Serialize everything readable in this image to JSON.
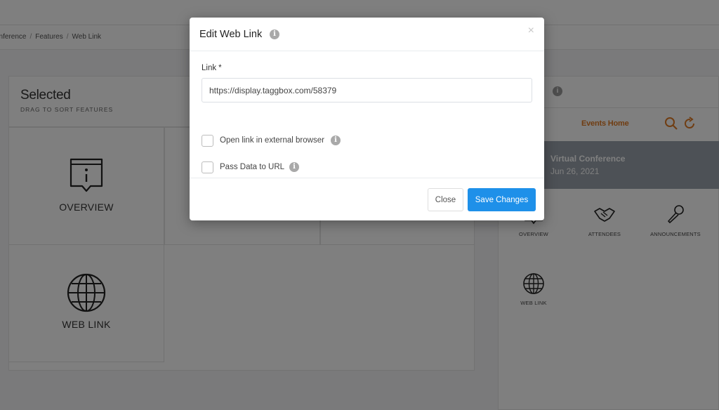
{
  "breadcrumb": [
    "onference",
    "Features",
    "Web Link"
  ],
  "selected_panel": {
    "title": "Selected",
    "subtitle": "DRAG TO SORT FEATURES",
    "tiles": [
      {
        "label": "OVERVIEW",
        "icon": "overview-icon"
      },
      {
        "label": "WEB LINK",
        "icon": "globe-icon"
      }
    ]
  },
  "preview": {
    "app_title": "Events Home",
    "banner_title": "Virtual Conference",
    "banner_date": "Jun 26, 2021",
    "features": [
      {
        "label": "OVERVIEW",
        "icon": "overview-icon"
      },
      {
        "label": "ATTENDEES",
        "icon": "handshake-icon"
      },
      {
        "label": "ANNOUNCEMENTS",
        "icon": "microphone-icon"
      },
      {
        "label": "WEB LINK",
        "icon": "globe-icon"
      }
    ],
    "accent_color": "#e07b24"
  },
  "modal": {
    "title": "Edit Web Link",
    "close_glyph": "×",
    "link_label": "Link",
    "required_mark": "*",
    "link_value": "https://display.taggbox.com/58379",
    "checkboxes": [
      {
        "label": "Open link in external browser",
        "checked": false
      },
      {
        "label": "Pass Data to URL",
        "checked": false
      }
    ],
    "close_button": "Close",
    "save_button": "Save Changes",
    "primary_color": "#1e90e9"
  }
}
